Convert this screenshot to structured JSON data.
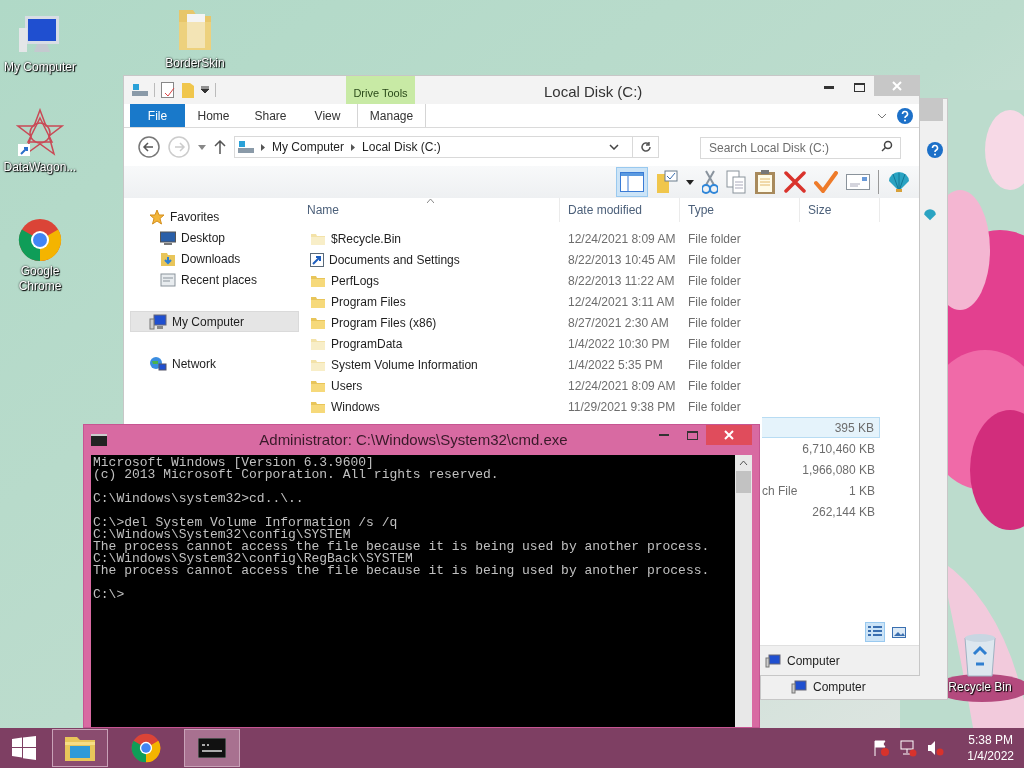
{
  "desktop_icons": [
    {
      "label": "My Computer",
      "kind": "computer"
    },
    {
      "label": "BorderSkin",
      "kind": "folder"
    },
    {
      "label": "DataWagon...",
      "kind": "app"
    },
    {
      "label": "Google Chrome",
      "kind": "browser"
    },
    {
      "label": "Recycle Bin",
      "kind": "recycle"
    }
  ],
  "back_window": {
    "status": "Computer"
  },
  "explorer": {
    "title": "Local Disk (C:)",
    "contextual_group": "Drive Tools",
    "tabs": [
      {
        "label": "File",
        "kind": "file"
      },
      {
        "label": "Home",
        "kind": "tab"
      },
      {
        "label": "Share",
        "kind": "tab"
      },
      {
        "label": "View",
        "kind": "tab"
      },
      {
        "label": "Manage",
        "kind": "contextual"
      }
    ],
    "address": [
      "My Computer",
      "Local Disk (C:)"
    ],
    "search": {
      "placeholder": "Search Local Disk (C:)"
    },
    "preview_pane": {
      "on": true
    },
    "nav": [
      {
        "label": "Favorites",
        "kind": "favorites",
        "selected": false,
        "children": [
          {
            "label": "Desktop",
            "kind": "desktop",
            "selected": false
          },
          {
            "label": "Downloads",
            "kind": "downloads",
            "selected": false
          },
          {
            "label": "Recent places",
            "kind": "recent",
            "selected": false
          }
        ]
      },
      {
        "label": "My Computer",
        "kind": "computer",
        "selected": true
      },
      {
        "label": "Network",
        "kind": "network",
        "selected": false
      }
    ],
    "columns": [
      "Name",
      "Date modified",
      "Type",
      "Size"
    ],
    "rows": [
      {
        "kind": "hidden_folder",
        "name": "$Recycle.Bin",
        "date": "12/24/2021 8:09 AM",
        "type": "File folder",
        "selected": false
      },
      {
        "kind": "shortcut",
        "name": "Documents and Settings",
        "date": "8/22/2013 10:45 AM",
        "type": "File folder",
        "selected": false
      },
      {
        "kind": "folder",
        "name": "PerfLogs",
        "date": "8/22/2013 11:22 AM",
        "type": "File folder",
        "selected": false
      },
      {
        "kind": "folder",
        "name": "Program Files",
        "date": "12/24/2021 3:11 AM",
        "type": "File folder",
        "selected": false
      },
      {
        "kind": "folder",
        "name": "Program Files (x86)",
        "date": "8/27/2021 2:30 AM",
        "type": "File folder",
        "selected": false
      },
      {
        "kind": "hidden_folder",
        "name": "ProgramData",
        "date": "1/4/2022 10:30 PM",
        "type": "File folder",
        "selected": false
      },
      {
        "kind": "hidden_folder",
        "name": "System Volume Information",
        "date": "1/4/2022 5:35 PM",
        "type": "File folder",
        "selected": false
      },
      {
        "kind": "folder",
        "name": "Users",
        "date": "12/24/2021 8:09 AM",
        "type": "File folder",
        "selected": false
      },
      {
        "kind": "folder",
        "name": "Windows",
        "date": "11/29/2021 9:38 PM",
        "type": "File folder",
        "selected": false
      },
      {
        "kind": "covered",
        "size": "395 KB",
        "selected": true
      },
      {
        "kind": "covered",
        "size": "6,710,460 KB",
        "selected": false
      },
      {
        "kind": "covered",
        "size": "1,966,080 KB",
        "selected": false
      },
      {
        "kind": "covered",
        "type": "ch File",
        "size": "1 KB",
        "selected": false
      },
      {
        "kind": "covered",
        "size": "262,144 KB",
        "selected": false
      }
    ],
    "view_buttons": [
      {
        "kind": "details",
        "selected": true
      },
      {
        "kind": "tiles",
        "selected": false
      }
    ],
    "status": "Computer"
  },
  "cmd": {
    "title": "Administrator: C:\\Windows\\System32\\cmd.exe",
    "blocks": [
      [
        "Microsoft Windows [Version 6.3.9600]",
        "(c) 2013 Microsoft Corporation. All rights reserved."
      ],
      [
        "C:\\Windows\\system32>cd..\\.."
      ],
      [
        "C:\\>del System Volume Information /s /q",
        "C:\\Windows\\System32\\config\\SYSTEM",
        "The process cannot access the file because it is being used by another process.",
        "C:\\Windows\\System32\\config\\RegBack\\SYSTEM",
        "The process cannot access the file because it is being used by another process."
      ],
      [
        "C:\\>"
      ]
    ]
  },
  "taskbar": {
    "apps": [
      {
        "kind": "explorer",
        "running": true,
        "selected": false
      },
      {
        "kind": "chrome",
        "running": false,
        "selected": false
      },
      {
        "kind": "cmd",
        "running": true,
        "selected": true
      }
    ],
    "time": "5:38 PM",
    "date": "1/4/2022"
  }
}
